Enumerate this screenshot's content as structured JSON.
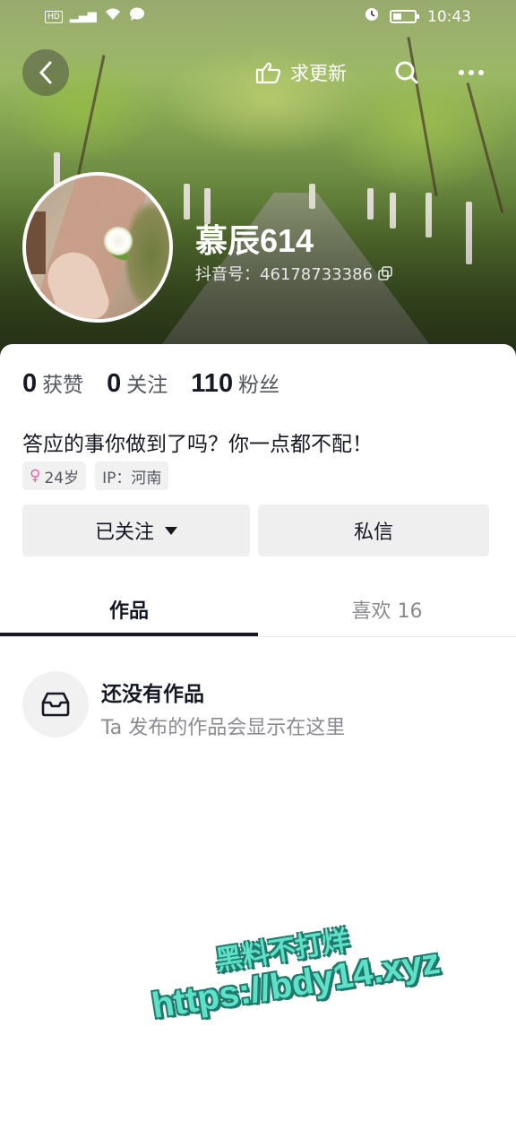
{
  "status_bar": {
    "time": "10:43",
    "hd": "HD",
    "network": "4G"
  },
  "nav": {
    "update_label": "求更新"
  },
  "profile": {
    "name": "慕辰614",
    "douyin_id": "抖音号：46178733386",
    "stats": [
      {
        "num": "0",
        "label": "获赞"
      },
      {
        "num": "0",
        "label": "关注"
      },
      {
        "num": "110",
        "label": "粉丝"
      }
    ],
    "bio": "答应的事你做到了吗？你一点都不配！",
    "tags": {
      "gender_symbol": "♀",
      "age": "24岁",
      "ip": "IP：河南"
    }
  },
  "actions": {
    "follow_label": "已关注",
    "message_label": "私信"
  },
  "tabs": {
    "works": "作品",
    "likes": "喜欢 16"
  },
  "empty": {
    "title": "还没有作品",
    "subtitle": "Ta 发布的作品会显示在这里"
  },
  "watermark": {
    "line1": "黑料不打烊",
    "line2": "https://bdy14.xyz"
  }
}
